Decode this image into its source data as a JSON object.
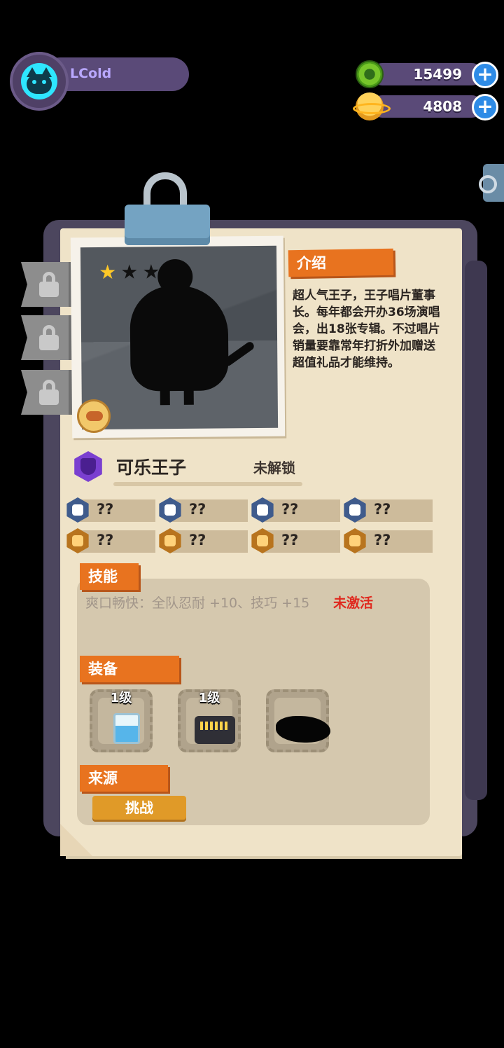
{
  "player": {
    "name": "LCold"
  },
  "currencies": [
    {
      "name": "green-gem",
      "value": "15499",
      "color": "#77c52a"
    },
    {
      "name": "gold-coin",
      "value": "4808",
      "color": "#ffc928"
    }
  ],
  "character": {
    "stars_filled": 1,
    "stars_total": 3,
    "name": "可乐王子",
    "status": "未解锁"
  },
  "intro": {
    "title": "介绍",
    "text": "超人气王子，王子唱片董事长。每年都会开办36场演唱会，出18张专辑。不过唱片销量要靠常年打折外加赠送超值礼品才能维持。"
  },
  "stats": [
    {
      "icon": "heart-icon",
      "value": "??"
    },
    {
      "icon": "flame-icon",
      "value": "??"
    },
    {
      "icon": "shield-icon",
      "value": "??"
    },
    {
      "icon": "anchor-icon",
      "value": "??"
    },
    {
      "icon": "gear-icon",
      "value": "??"
    },
    {
      "icon": "smile-icon",
      "value": "??"
    },
    {
      "icon": "muscle-icon",
      "value": "??"
    },
    {
      "icon": "brain-icon",
      "value": "??"
    }
  ],
  "skill": {
    "title": "技能",
    "text": "爽口畅快：全队忍耐 +10、技巧 +15",
    "state": "未激活",
    "state_color": "#e0281e"
  },
  "equipment": {
    "title": "装备",
    "items": [
      {
        "level": "1级",
        "icon": "cup-icon"
      },
      {
        "level": "1级",
        "icon": "radio-icon"
      },
      {
        "level": "",
        "icon": "locked-silhouette-icon"
      }
    ]
  },
  "source": {
    "title": "来源",
    "button": "挑战"
  }
}
